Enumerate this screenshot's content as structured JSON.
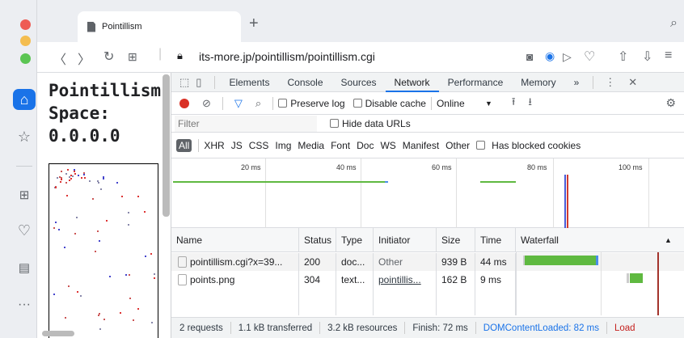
{
  "window": {
    "traffic_lights": [
      "#ee5c54",
      "#f4bd50",
      "#5bc553"
    ]
  },
  "tab": {
    "title": "Pointillism",
    "close": "✕"
  },
  "new_tab": "+",
  "toolbar": {
    "url": "its-more.jp/pointillism/pointillism.cgi"
  },
  "page": {
    "title": "Pointillism\nSpace:\n0.0.0.0"
  },
  "devtools": {
    "tabs": [
      "Elements",
      "Console",
      "Sources",
      "Network",
      "Performance",
      "Memory",
      "»"
    ],
    "selected_tab": "Network",
    "preserve_log": "Preserve log",
    "disable_cache": "Disable cache",
    "throttle": "Online",
    "filter_placeholder": "Filter",
    "hide_data_urls": "Hide data URLs",
    "types": [
      "All",
      "XHR",
      "JS",
      "CSS",
      "Img",
      "Media",
      "Font",
      "Doc",
      "WS",
      "Manifest",
      "Other"
    ],
    "blocked_cookies": "Has blocked cookies",
    "ticks": [
      "20 ms",
      "40 ms",
      "60 ms",
      "80 ms",
      "100 ms"
    ],
    "headers": [
      "Name",
      "Status",
      "Type",
      "Initiator",
      "Size",
      "Time",
      "Waterfall"
    ],
    "rows": [
      {
        "name": "pointillism.cgi?x=39...",
        "status": "200",
        "type": "doc...",
        "initiator": "Other",
        "size": "939 B",
        "time": "44 ms"
      },
      {
        "name": "points.png",
        "status": "304",
        "type": "text...",
        "initiator": "pointillis...",
        "size": "162 B",
        "time": "9 ms"
      }
    ],
    "status": {
      "requests": "2 requests",
      "transferred": "1.1 kB transferred",
      "resources": "3.2 kB resources",
      "finish": "Finish: 72 ms",
      "dcl": "DOMContentLoaded: 82 ms",
      "load": "Load"
    }
  }
}
